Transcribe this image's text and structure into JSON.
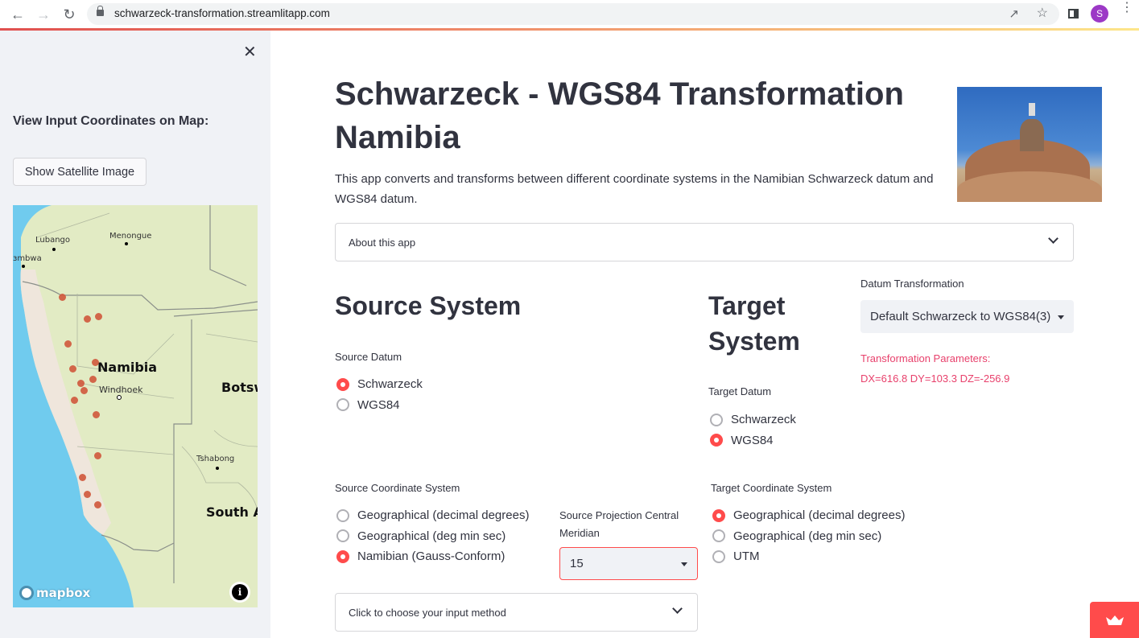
{
  "browser": {
    "url": "schwarzeck-transformation.streamlitapp.com",
    "profile_initial": "S",
    "icons": [
      "back-arrow-icon",
      "forward-arrow-icon",
      "reload-icon",
      "lock-icon",
      "share-icon",
      "star-icon",
      "side-panel-icon",
      "menu-dots-icon"
    ]
  },
  "sidebar": {
    "heading": "View Input Coordinates on Map:",
    "satellite_button": "Show Satellite Image",
    "map": {
      "attribution": "mapbox",
      "labels": {
        "lubango": "Lubango",
        "menongue": "Menongue",
        "namibe": "ɜmbwa",
        "namibia": "Namibia",
        "windhoek": "Windhoek",
        "botswana": "Botsw",
        "tshabong": "Tshabong",
        "south_africa": "South Af"
      },
      "marker_count": 15,
      "marker_color": "#d05a3e"
    }
  },
  "main": {
    "title": "Schwarzeck - WGS84 Transformation Namibia",
    "intro": "This app converts and transforms between different coordinate systems in the Namibian Schwarzeck datum and WGS84 datum.",
    "about_expander": "About this app",
    "source": {
      "heading": "Source System",
      "datum_label": "Source Datum",
      "datum_options": [
        "Schwarzeck",
        "WGS84"
      ],
      "datum_selected": "Schwarzeck",
      "cs_label": "Source Coordinate System",
      "cs_options": [
        "Geographical (decimal degrees)",
        "Geographical (deg min sec)",
        "Namibian (Gauss-Conform)"
      ],
      "cs_selected": "Namibian (Gauss-Conform)",
      "meridian_label": "Source Projection Central Meridian",
      "meridian_value": "15",
      "input_method_expander": "Click to choose your input method"
    },
    "target": {
      "heading": "Target System",
      "datum_label": "Target Datum",
      "datum_options": [
        "Schwarzeck",
        "WGS84"
      ],
      "datum_selected": "WGS84",
      "cs_label": "Target Coordinate System",
      "cs_options": [
        "Geographical (decimal degrees)",
        "Geographical (deg min sec)",
        "UTM"
      ],
      "cs_selected": "Geographical (decimal degrees)"
    },
    "datum_transformation": {
      "label": "Datum Transformation",
      "value": "Default Schwarzeck to WGS84(3)",
      "params_title": "Transformation Parameters:",
      "params_values": "DX=616.8 DY=103.3 DZ=-256.9"
    }
  },
  "colors": {
    "accent": "#ff4b4b",
    "params_text": "#e8416c",
    "sidebar_bg": "#f0f2f6",
    "text": "#31333f"
  }
}
